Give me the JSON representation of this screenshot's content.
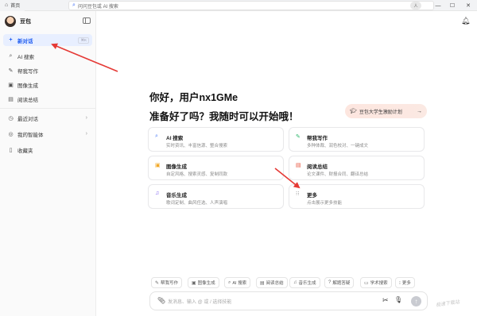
{
  "titlebar": {
    "tab_label": "首页",
    "address_text": "问问豆包或 AI 搜索",
    "avatar_label": "人"
  },
  "sidebar": {
    "brand_name": "豆包",
    "new_chat_label": "新对话",
    "new_chat_shortcut": "⌘K",
    "items": [
      {
        "label": "AI 搜索",
        "icon": "search-icon"
      },
      {
        "label": "帮我写作",
        "icon": "pen-icon"
      },
      {
        "label": "图像生成",
        "icon": "image-icon"
      },
      {
        "label": "阅读总结",
        "icon": "document-icon"
      }
    ],
    "recent_label": "最近对话",
    "agents_label": "我的智能体",
    "favorites_label": "收藏夹"
  },
  "main": {
    "greeting_line1": "你好，用户nx1GMe",
    "greeting_line2": "准备好了吗？我随时可以开始哦！",
    "promo_label": "豆包大学生激励计划",
    "cards": [
      {
        "title": "AI 搜索",
        "subtitle": "实时资讯、丰富信源、整合搜索",
        "icon": "search-icon",
        "color": "#4a7bf7"
      },
      {
        "title": "帮我写作",
        "subtitle": "多种体裁、润色校对、一键成文",
        "icon": "pen-icon",
        "color": "#2fb86c"
      },
      {
        "title": "图像生成",
        "subtitle": "自定风格、搜索灵感、复制同款",
        "icon": "image-icon",
        "color": "#f2a928"
      },
      {
        "title": "阅读总结",
        "subtitle": "论文课件、财报合同、翻译总结",
        "icon": "document-icon",
        "color": "#e8543d"
      },
      {
        "title": "音乐生成",
        "subtitle": "歌词定制、曲风任选、人声演唱",
        "icon": "music-icon",
        "color": "#7a5cf0"
      },
      {
        "title": "更多",
        "subtitle": "点击展示更多技能",
        "icon": "grid-icon",
        "color": "#888888"
      }
    ],
    "chips": [
      {
        "label": "帮我写作",
        "icon": "pen-icon"
      },
      {
        "label": "图像生成",
        "icon": "image-icon"
      },
      {
        "label": "AI 搜索",
        "icon": "search-icon"
      },
      {
        "label": "阅读总结",
        "icon": "document-icon"
      },
      {
        "label": "音乐生成",
        "icon": "music-icon"
      },
      {
        "label": "解题答疑",
        "icon": "question-icon"
      },
      {
        "label": "学术搜索",
        "icon": "book-icon"
      },
      {
        "label": "更多",
        "icon": "grid-icon"
      }
    ],
    "input_placeholder": "发消息、输入 @ 或 / 选择技能"
  },
  "watermark": "极速下载站",
  "colors": {
    "accent": "#1f5cf0",
    "annotation": "#e53935"
  }
}
